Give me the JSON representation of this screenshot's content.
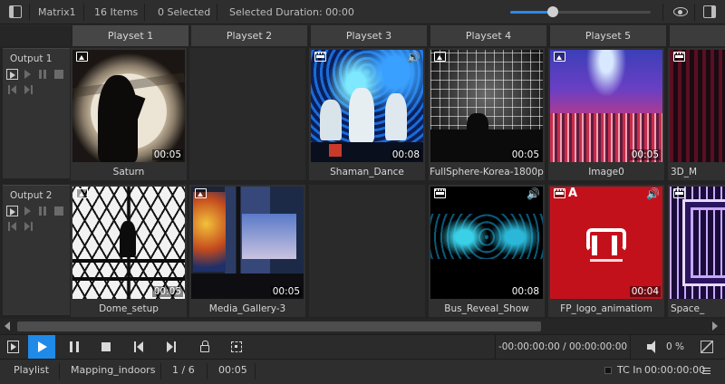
{
  "topbar": {
    "matrix_label": "Matrix1",
    "items_count": "16 Items",
    "selected": "0 Selected",
    "selected_duration": "Selected Duration: 00:00",
    "zoom_level": 0.3
  },
  "columns": [
    {
      "label": "Playset 1"
    },
    {
      "label": "Playset 2"
    },
    {
      "label": "Playset 3"
    },
    {
      "label": "Playset 4"
    },
    {
      "label": "Playset 5"
    },
    {
      "label": ""
    }
  ],
  "rows": [
    {
      "label": "Output 1"
    },
    {
      "label": "Output 2"
    }
  ],
  "cells": {
    "r1c1": {
      "name": "Saturn",
      "duration": "00:05",
      "type": "image"
    },
    "r1c3": {
      "name": "Shaman_Dance",
      "duration": "00:08",
      "type": "video"
    },
    "r1c4": {
      "name": "FullSphere-Korea-1800p",
      "duration": "00:05",
      "type": "image"
    },
    "r1c5": {
      "name": "Image0",
      "duration": "00:05",
      "type": "image"
    },
    "r1c6": {
      "name": "3D_M",
      "duration": "",
      "type": "video"
    },
    "r2c1": {
      "name": "Dome_setup",
      "duration": "00:05",
      "type": "image"
    },
    "r2c2": {
      "name": "Media_Gallery-3",
      "duration": "00:05",
      "type": "image"
    },
    "r2c4": {
      "name": "Bus_Reveal_Show",
      "duration": "00:08",
      "type": "video"
    },
    "r2c5": {
      "name": "FP_logo_animatiom",
      "duration": "00:04",
      "type": "video",
      "extra_badge": "A"
    },
    "r2c6": {
      "name": "Space_",
      "duration": "",
      "type": "video"
    }
  },
  "transport": {
    "timecode": "-00:00:00:00 / 00:00:00:00",
    "volume": "0 %",
    "active_button": "play"
  },
  "statusbar": {
    "mode": "Playlist",
    "project": "Mapping_indoors",
    "position": "1 / 6",
    "duration": "00:05",
    "tc_label": "TC In",
    "tc_value": "00:00:00:00"
  },
  "colors": {
    "accent": "#1f8ae8",
    "background": "#2b2b2b"
  },
  "icons": {
    "audio": "🔊"
  }
}
